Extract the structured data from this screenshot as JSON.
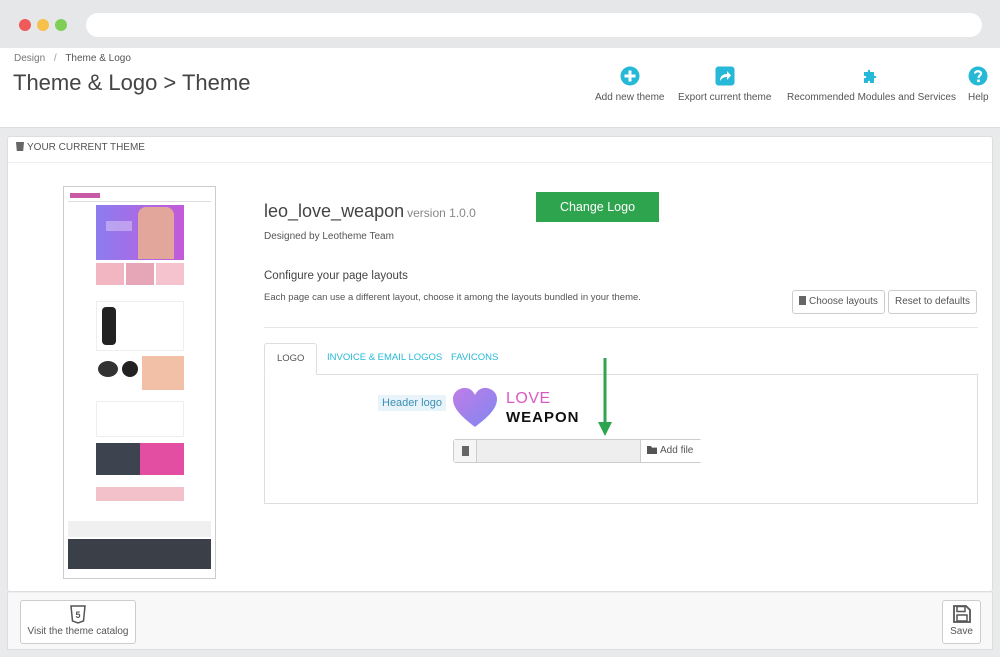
{
  "breadcrumb": {
    "parent": "Design",
    "separator": "/",
    "current": "Theme & Logo"
  },
  "page_title": "Theme & Logo > Theme",
  "toolbar": {
    "add_new_theme": "Add new theme",
    "export_current_theme": "Export current theme",
    "recommended_modules": "Recommended Modules and Services",
    "help": "Help",
    "icon_color": "#25b9d7"
  },
  "panel": {
    "heading": "YOUR CURRENT THEME",
    "theme_name": "leo_love_weapon",
    "theme_version": "version 1.0.0",
    "designed_by": "Designed by Leotheme Team",
    "configure_title": "Configure your page layouts",
    "configure_desc": "Each page can use a different layout, choose it among the layouts bundled in your theme.",
    "choose_layouts": "Choose layouts",
    "reset_defaults": "Reset to defaults"
  },
  "tabs": [
    {
      "label": "LOGO",
      "active": true
    },
    {
      "label": "INVOICE & EMAIL LOGOS",
      "active": false
    },
    {
      "label": "FAVICONS",
      "active": false
    }
  ],
  "logo_tab": {
    "header_logo_label": "Header logo",
    "logo_word_1": "LOVE",
    "logo_word_2": "WEAPON",
    "add_file": "Add file",
    "file_value": ""
  },
  "callout": {
    "text": "Change Logo",
    "color": "#2ea44f"
  },
  "footer": {
    "visit_catalog": "Visit the theme catalog",
    "save": "Save"
  }
}
